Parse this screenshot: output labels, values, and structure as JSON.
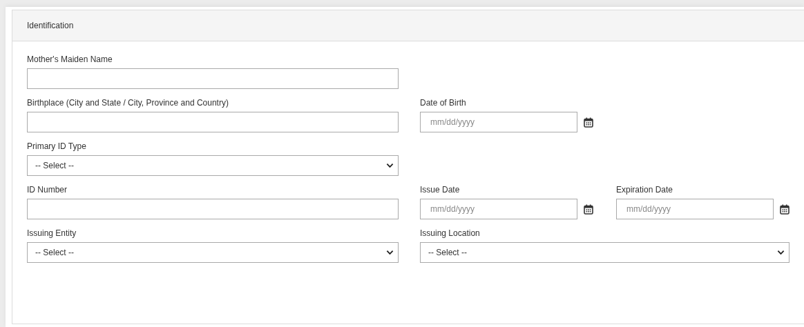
{
  "panel": {
    "title": "Identification"
  },
  "rows": [
    {
      "fields": [
        {
          "kind": "text",
          "label": "Mother's Maiden Name"
        }
      ]
    },
    {
      "fields": [
        {
          "kind": "text",
          "label": "Birthplace (City and State / City, Province and Country)"
        },
        {
          "kind": "date",
          "label": "Date of Birth",
          "placeholder": "mm/dd/yyyy"
        }
      ]
    },
    {
      "fields": [
        {
          "kind": "select",
          "label": "Primary ID Type",
          "value": "-- Select --"
        }
      ]
    },
    {
      "fields": [
        {
          "kind": "text",
          "label": "ID Number"
        },
        {
          "kind": "date",
          "label": "Issue Date",
          "placeholder": "mm/dd/yyyy"
        },
        {
          "kind": "date",
          "label": "Expiration Date",
          "placeholder": "mm/dd/yyyy"
        }
      ]
    },
    {
      "fields": [
        {
          "kind": "select",
          "label": "Issuing Entity",
          "value": "-- Select --"
        },
        {
          "kind": "select",
          "label": "Issuing Location",
          "value": "-- Select --"
        }
      ]
    }
  ]
}
